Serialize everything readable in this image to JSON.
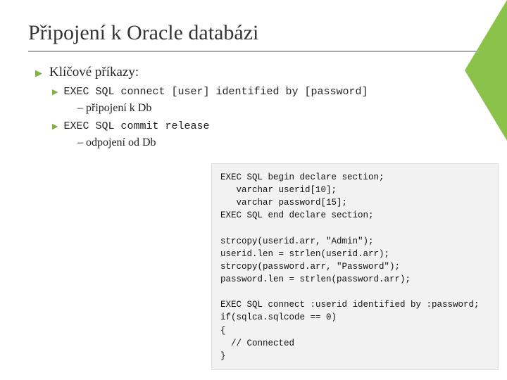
{
  "title": "Připojení k Oracle databázi",
  "b1": "Klíčové příkazy:",
  "b2_code": "EXEC SQL connect [user] identified by [password]",
  "b2_desc": "– připojení k Db",
  "b3_code": "EXEC SQL commit release",
  "b3_desc": "– odpojení od Db",
  "codebox": "EXEC SQL begin declare section;\n   varchar userid[10];\n   varchar password[15];\nEXEC SQL end declare section;\n\nstrcopy(userid.arr, \"Admin\");\nuserid.len = strlen(userid.arr);\nstrcopy(password.arr, \"Password\");\npassword.len = strlen(password.arr);\n\nEXEC SQL connect :userid identified by :password;\nif(sqlca.sqlcode == 0)\n{\n  // Connected\n}"
}
